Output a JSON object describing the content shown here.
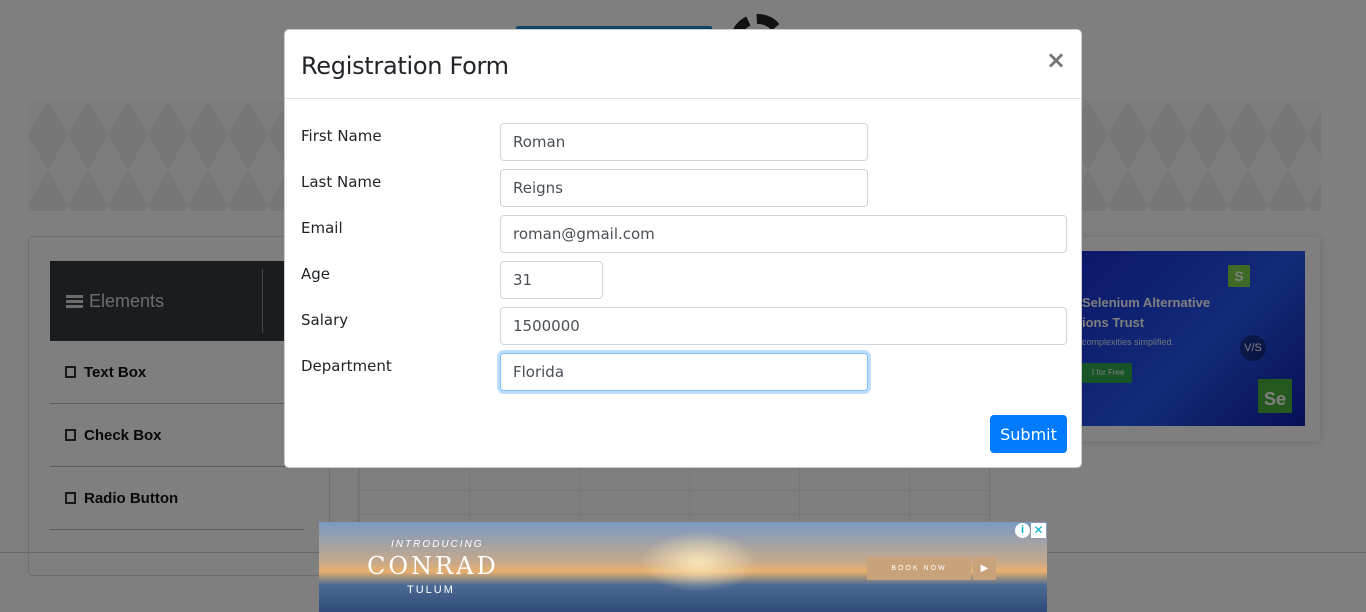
{
  "background": {
    "panel": {
      "header_label": "Elements",
      "items": [
        {
          "label": "Text Box"
        },
        {
          "label": "Check Box"
        },
        {
          "label": "Radio Button"
        }
      ]
    },
    "right_ad": {
      "title_line1": "Selenium Alternative",
      "title_line2": "ions Trust",
      "subtitle": "complexities simplified.",
      "cta": "t for Free",
      "badge_s": "S",
      "badge_vs": "V/S",
      "badge_se": "Se"
    }
  },
  "modal": {
    "title": "Registration Form",
    "close_label": "×",
    "fields": [
      {
        "label": "First Name",
        "value": "Roman"
      },
      {
        "label": "Last Name",
        "value": "Reigns"
      },
      {
        "label": "Email",
        "value": "roman@gmail.com"
      },
      {
        "label": "Age",
        "value": "31"
      },
      {
        "label": "Salary",
        "value": "1500000"
      },
      {
        "label": "Department",
        "value": "Florida"
      }
    ],
    "submit_label": "Submit"
  },
  "bottom_ad": {
    "intro": "INTRODUCING",
    "brand": "CONRAD",
    "sub": "TULUM",
    "cta": "BOOK NOW",
    "arrow": "▶",
    "info": "i",
    "close": "✕"
  },
  "colors": {
    "primary": "#007bff",
    "panel_dark": "#343a40",
    "focus_border": "#80bdff"
  }
}
